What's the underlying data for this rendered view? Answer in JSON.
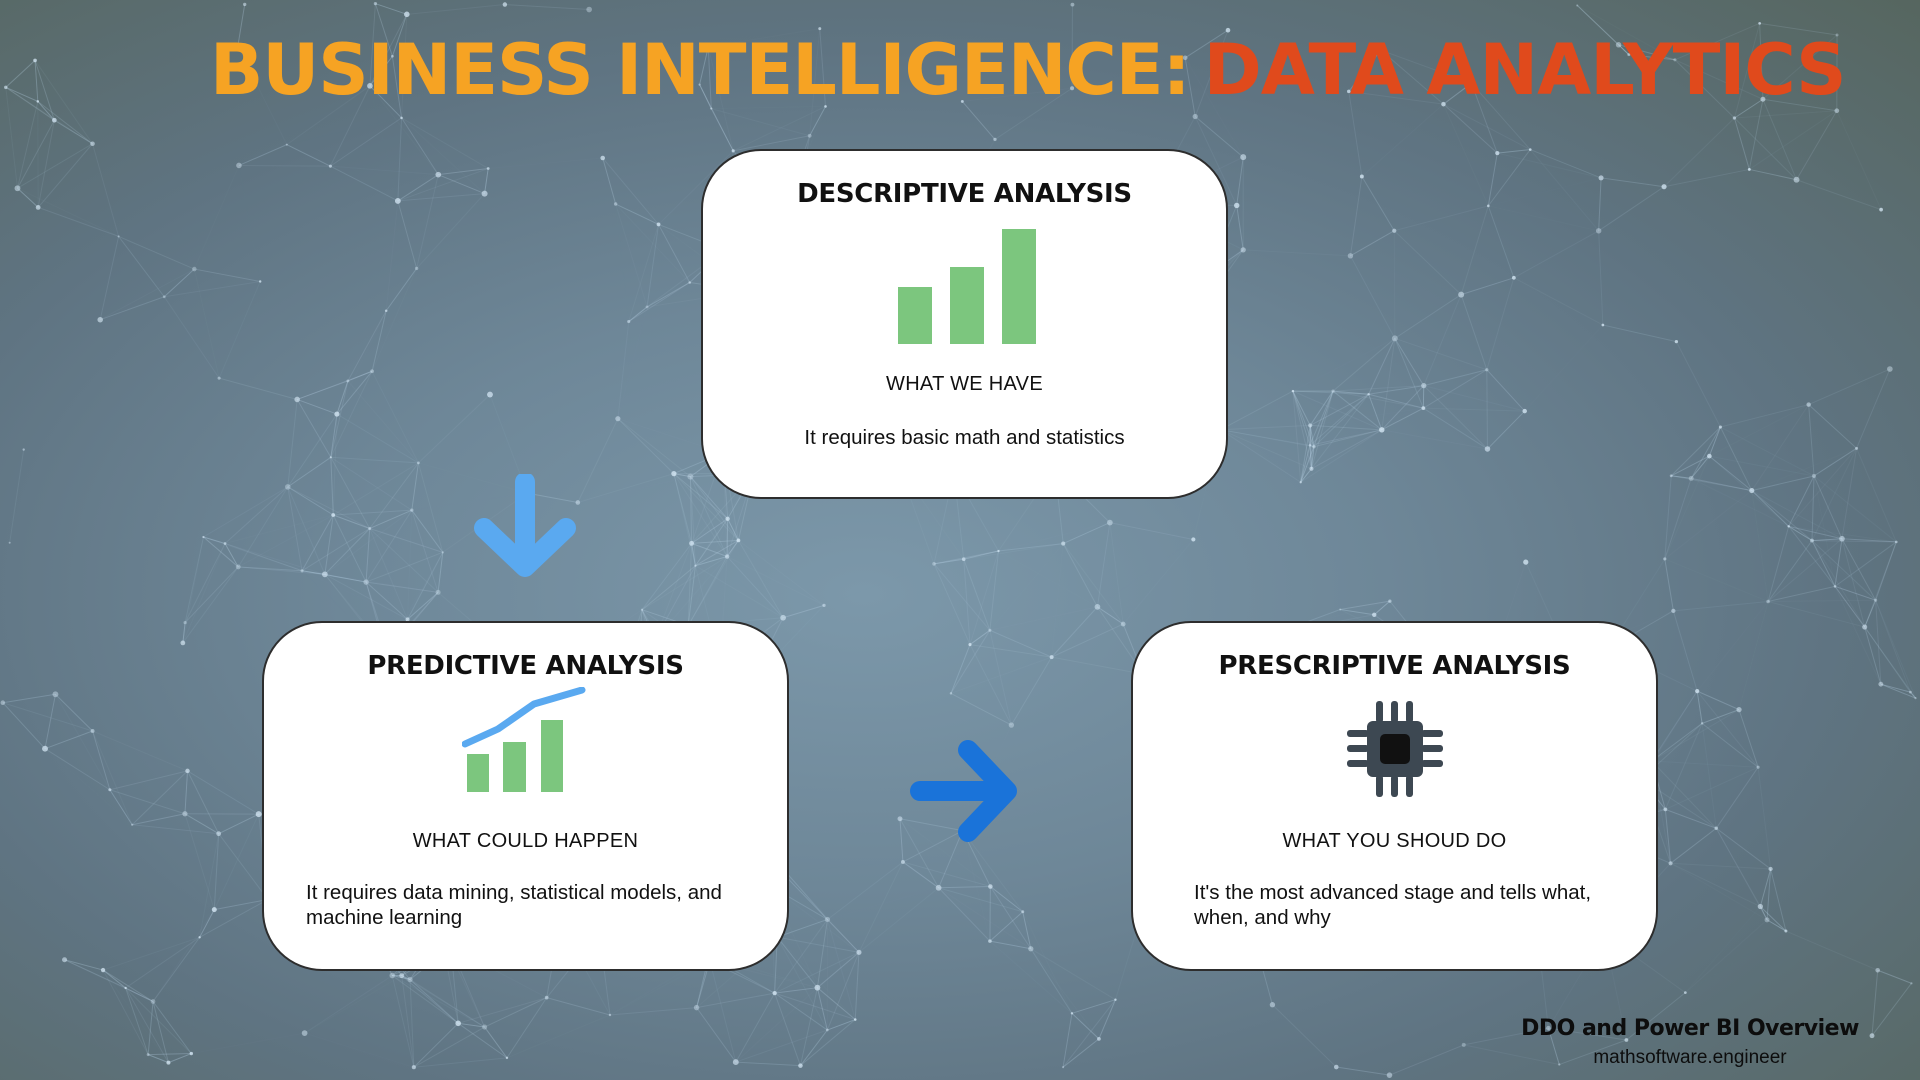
{
  "title": {
    "part1": "BUSINESS INTELLIGENCE:",
    "part2": "DATA ANALYTICS",
    "color1": "#f6a323",
    "color2": "#e04a1c"
  },
  "cards": {
    "descriptive": {
      "title": "DESCRIPTIVE ANALYSIS",
      "subtitle": "WHAT WE HAVE",
      "description": "It requires basic math and statistics",
      "icon": "bar-chart-icon"
    },
    "predictive": {
      "title": "PREDICTIVE ANALYSIS",
      "subtitle": "WHAT COULD HAPPEN",
      "description": "It requires data mining, statistical models, and machine learning",
      "icon": "trend-chart-icon"
    },
    "prescriptive": {
      "title": "PRESCRIPTIVE ANALYSIS",
      "subtitle": "WHAT YOU SHOUD DO",
      "description": "It's the most advanced stage and tells what, when, and why",
      "icon": "chip-icon"
    }
  },
  "arrows": {
    "down": "arrow-down-icon",
    "right": "arrow-right-icon",
    "down_color": "#5aa9f0",
    "right_color": "#1a73d9"
  },
  "footer": {
    "title": "DDO and Power BI Overview",
    "site": "mathsoftware.engineer"
  },
  "colors": {
    "bar_green": "#7cc67e",
    "trend_blue": "#5aa9f0",
    "chip_dark": "#3d4852",
    "chip_core": "#111111"
  }
}
